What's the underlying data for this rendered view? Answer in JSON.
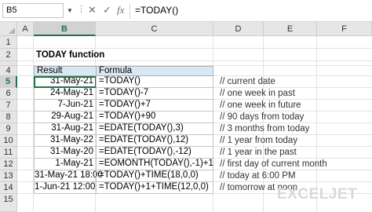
{
  "name_box": "B5",
  "formula_bar": "=TODAY()",
  "columns": [
    "A",
    "B",
    "C",
    "D",
    "E",
    "F"
  ],
  "rows": [
    "1",
    "2",
    "3",
    "4",
    "5",
    "6",
    "7",
    "8",
    "9",
    "10",
    "11",
    "12",
    "13",
    "14",
    "15"
  ],
  "title": "TODAY function",
  "headers": {
    "result": "Result",
    "formula": "Formula"
  },
  "data_rows": [
    {
      "result": "31-May-21",
      "formula": "=TODAY()",
      "comment": "// current date"
    },
    {
      "result": "24-May-21",
      "formula": "=TODAY()-7",
      "comment": "// one week in past"
    },
    {
      "result": "7-Jun-21",
      "formula": "=TODAY()+7",
      "comment": "// one week in future"
    },
    {
      "result": "29-Aug-21",
      "formula": "=TODAY()+90",
      "comment": "// 90 days from today"
    },
    {
      "result": "31-Aug-21",
      "formula": "=EDATE(TODAY(),3)",
      "comment": "// 3 months from today"
    },
    {
      "result": "31-May-22",
      "formula": "=EDATE(TODAY(),12)",
      "comment": "// 1 year from today"
    },
    {
      "result": "31-May-20",
      "formula": "=EDATE(TODAY(),-12)",
      "comment": "// 1 year in the past"
    },
    {
      "result": "1-May-21",
      "formula": "=EOMONTH(TODAY(),-1)+1",
      "comment": "// first day of current month"
    },
    {
      "result": "31-May-21 18:00",
      "formula": "=TODAY()+TIME(18,0,0)",
      "comment": "// today at 6:00 PM"
    },
    {
      "result": "1-Jun-21 12:00",
      "formula": "=TODAY()+1+TIME(12,0,0)",
      "comment": "// tomorrow at noon"
    }
  ],
  "logo": "EXCELJET",
  "accent": "#217346"
}
